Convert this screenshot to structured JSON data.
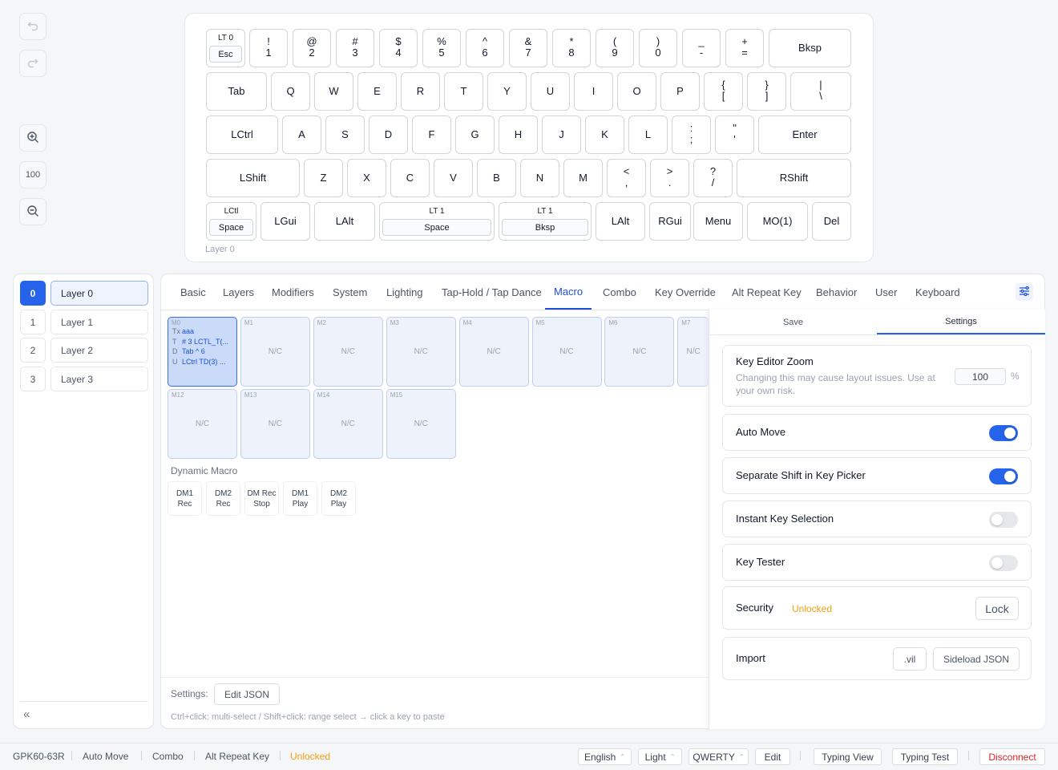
{
  "toolbar": {
    "zoom_value": "100",
    "undo_icon": "undo-icon",
    "redo_icon": "redo-icon",
    "zoom_in_icon": "zoom-in-icon",
    "zoom_out_icon": "zoom-out-icon"
  },
  "keyboard": {
    "layer_label": "Layer 0",
    "rows": [
      [
        {
          "t": "LT 0",
          "b": "Esc"
        },
        {
          "t": "!",
          "b": "1"
        },
        {
          "t": "@",
          "b": "2"
        },
        {
          "t": "#",
          "b": "3"
        },
        {
          "t": "$",
          "b": "4"
        },
        {
          "t": "%",
          "b": "5"
        },
        {
          "t": "^",
          "b": "6"
        },
        {
          "t": "&",
          "b": "7"
        },
        {
          "t": "*",
          "b": "8"
        },
        {
          "t": "(",
          "b": "9"
        },
        {
          "t": ")",
          "b": "0"
        },
        {
          "t": "_",
          "b": "-"
        },
        {
          "t": "+",
          "b": "="
        },
        {
          "l": "Bksp"
        }
      ],
      [
        {
          "l": "Tab"
        },
        {
          "l": "Q"
        },
        {
          "l": "W"
        },
        {
          "l": "E"
        },
        {
          "l": "R"
        },
        {
          "l": "T"
        },
        {
          "l": "Y"
        },
        {
          "l": "U"
        },
        {
          "l": "I"
        },
        {
          "l": "O"
        },
        {
          "l": "P"
        },
        {
          "t": "{",
          "b": "["
        },
        {
          "t": "}",
          "b": "]"
        },
        {
          "t": "|",
          "b": "\\"
        }
      ],
      [
        {
          "l": "LCtrl"
        },
        {
          "l": "A"
        },
        {
          "l": "S"
        },
        {
          "l": "D"
        },
        {
          "l": "F"
        },
        {
          "l": "G"
        },
        {
          "l": "H"
        },
        {
          "l": "J"
        },
        {
          "l": "K"
        },
        {
          "l": "L"
        },
        {
          "t": ":",
          "b": ";"
        },
        {
          "t": "\"",
          "b": "'"
        },
        {
          "l": "Enter"
        }
      ],
      [
        {
          "l": "LShift"
        },
        {
          "l": "Z"
        },
        {
          "l": "X"
        },
        {
          "l": "C"
        },
        {
          "l": "V"
        },
        {
          "l": "B"
        },
        {
          "l": "N"
        },
        {
          "l": "M"
        },
        {
          "t": "<",
          "b": ","
        },
        {
          "t": ">",
          "b": "."
        },
        {
          "t": "?",
          "b": "/"
        },
        {
          "l": "RShift"
        }
      ],
      [
        {
          "t": "LCtl",
          "b": "Space"
        },
        {
          "l": "LGui"
        },
        {
          "l": "LAlt"
        },
        {
          "t": "LT 1",
          "b": "Space"
        },
        {
          "t": "LT 1",
          "b": "Bksp"
        },
        {
          "l": "LAlt"
        },
        {
          "l": "RGui"
        },
        {
          "l": "Menu"
        },
        {
          "l": "MO(1)"
        },
        {
          "l": "Del"
        }
      ]
    ]
  },
  "layers": [
    {
      "num": "0",
      "name": "Layer 0"
    },
    {
      "num": "1",
      "name": "Layer 1"
    },
    {
      "num": "2",
      "name": "Layer 2"
    },
    {
      "num": "3",
      "name": "Layer 3"
    }
  ],
  "collapse_label": "«",
  "tabs": [
    "Basic",
    "Layers",
    "Modifiers",
    "System",
    "Lighting",
    "Tap-Hold / Tap Dance",
    "Macro",
    "Combo",
    "Key Override",
    "Alt Repeat Key",
    "Behavior",
    "User",
    "Keyboard"
  ],
  "active_tab": "Macro",
  "macros": {
    "row1": [
      {
        "id": "M0",
        "sel": true,
        "lines": [
          {
            "k": "Tx",
            "v": "aaa"
          },
          {
            "k": "T",
            "v": "# 3 LCTL_T(..."
          },
          {
            "k": "D",
            "v": "Tab ^ 6"
          },
          {
            "k": "U",
            "v": "LCtrl TD(3) ..."
          }
        ]
      },
      {
        "id": "M1",
        "nc": "N/C"
      },
      {
        "id": "M2",
        "nc": "N/C"
      },
      {
        "id": "M3",
        "nc": "N/C"
      },
      {
        "id": "M4",
        "nc": "N/C"
      },
      {
        "id": "M5",
        "nc": "N/C"
      },
      {
        "id": "M6",
        "nc": "N/C"
      },
      {
        "id": "M7",
        "nc": "N/C"
      }
    ],
    "row2": [
      {
        "id": "M12",
        "nc": "N/C"
      },
      {
        "id": "M13",
        "nc": "N/C"
      },
      {
        "id": "M14",
        "nc": "N/C"
      },
      {
        "id": "M15",
        "nc": "N/C"
      }
    ]
  },
  "dynamic_macro": {
    "title": "Dynamic Macro",
    "keys": [
      [
        "DM1",
        "Rec"
      ],
      [
        "DM2",
        "Rec"
      ],
      [
        "DM Rec",
        "Stop"
      ],
      [
        "DM1",
        "Play"
      ],
      [
        "DM2",
        "Play"
      ]
    ]
  },
  "footer": {
    "settings_label": "Settings:",
    "edit_json": "Edit JSON",
    "hint": "Ctrl+click: multi-select / Shift+click: range select → click a key to paste"
  },
  "settings_panel": {
    "tabs": [
      "Save",
      "Settings"
    ],
    "active": "Settings",
    "zoom": {
      "title": "Key Editor Zoom",
      "desc": "Changing this may cause layout issues. Use at your own risk.",
      "value": "100",
      "unit": "%"
    },
    "toggles": [
      {
        "label": "Auto Move",
        "on": true
      },
      {
        "label": "Separate Shift in Key Picker",
        "on": true
      },
      {
        "label": "Instant Key Selection",
        "on": false
      },
      {
        "label": "Key Tester",
        "on": false
      }
    ],
    "security": {
      "label": "Security",
      "status": "Unlocked",
      "button": "Lock"
    },
    "import": {
      "label": "Import",
      "vil": ".vil",
      "sideload": "Sideload JSON"
    },
    "colors": {
      "accent": "#2563eb",
      "warning": "#f59e0b",
      "danger": "#dc2626"
    }
  },
  "status_bar": {
    "items": [
      "GPK60-63R",
      "Auto Move",
      "Combo",
      "Alt Repeat Key"
    ],
    "lock_state": "Unlocked",
    "language": "English",
    "theme": "Light",
    "layout": "QWERTY",
    "edit": "Edit",
    "typing_view": "Typing View",
    "typing_test": "Typing Test",
    "disconnect": "Disconnect"
  }
}
